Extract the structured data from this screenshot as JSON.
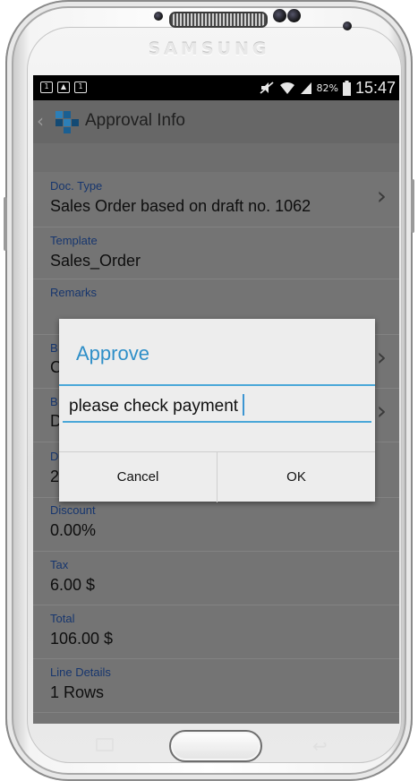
{
  "device": {
    "brand": "SAMSUNG"
  },
  "statusbar": {
    "battery": "82%",
    "time": "15:47"
  },
  "actionbar": {
    "title": "Approval Info",
    "back_icon": "chevron-left-icon"
  },
  "fields": [
    {
      "label": "Doc. Type",
      "value": "Sales Order based on draft no. 1062"
    },
    {
      "label": "Template",
      "value": "Sales_Order"
    },
    {
      "label": "Remarks",
      "value": ""
    },
    {
      "label": "B",
      "value": "C"
    },
    {
      "label": "B",
      "value": "D"
    },
    {
      "label": "D",
      "value": "2"
    },
    {
      "label": "Discount",
      "value": "0.00%"
    },
    {
      "label": "Tax",
      "value": "6.00 $"
    },
    {
      "label": "Total",
      "value": "106.00 $"
    },
    {
      "label": "Line Details",
      "value": "1 Rows"
    }
  ],
  "dialog": {
    "title": "Approve",
    "input_value": "please check payment",
    "cancel_label": "Cancel",
    "ok_label": "OK"
  },
  "colors": {
    "accent": "#2f8fc8",
    "label": "#17366e",
    "overlay": "#747474"
  }
}
